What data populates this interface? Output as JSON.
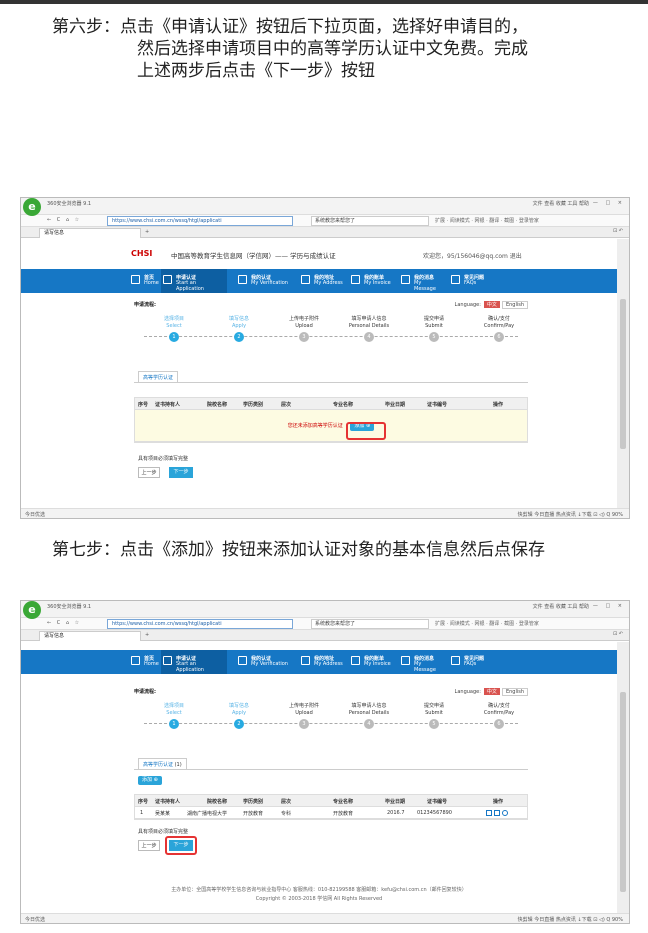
{
  "steps": {
    "step6": [
      "第六步：点击《申请认证》按钮后下拉页面，选择好申请目的，",
      "然后选择申请项目中的高等学历认证中文免费。完成",
      "上述两步后点击《下一步》按钮"
    ],
    "step7": "第七步：点击《添加》按钮来添加认证对象的基本信息然后点保存"
  },
  "browser": {
    "logo_glyph": "e",
    "title": "360安全浏览器 9.1",
    "menu": "文件  查看  收藏  工具  帮助",
    "nav_buttons": "← C ⌂ ☆",
    "url": "https://www.chsi.com.cn/wssq/htgl/applicati",
    "search": "系统教您来帮您了",
    "addr_tools": "扩展 · 阅读模式 · 网银 · 翻译 · 截图 · 登录管家",
    "tab_title": "请写信息",
    "tab_plus": "+",
    "tab_right": "⊡ ↶",
    "window_buttons": "— □ ×",
    "status_left": "今日优选",
    "status_right": "快剪辑  今日直播  热点资讯  ↓下载  ⊡  ◁)  Q 90%"
  },
  "site": {
    "logo": "CHSI",
    "name": "中国高等教育学生信息网（学信网）—— 学历与成绩认证",
    "user": "欢迎您，95/156046@qq.com   退出",
    "nav": [
      {
        "cn": "首页",
        "en": "Home",
        "en2": ""
      },
      {
        "cn": "申请认证",
        "en": "Start an",
        "en2": "Application"
      },
      {
        "cn": "我的认证",
        "en": "My Verification",
        "en2": ""
      },
      {
        "cn": "我的地址",
        "en": "My Address",
        "en2": ""
      },
      {
        "cn": "我的账单",
        "en": "My Invoice",
        "en2": ""
      },
      {
        "cn": "我的消息",
        "en": "My",
        "en2": "Message"
      },
      {
        "cn": "常见问题",
        "en": "FAQs",
        "en2": ""
      }
    ],
    "progress_title": "申请流程:",
    "lang_label": "Language:",
    "lang_cn": "中文",
    "lang_en": "English",
    "steps": [
      {
        "cn": "选择项目",
        "en": "Select",
        "n": "1"
      },
      {
        "cn": "填写信息",
        "en": "Apply",
        "n": "2"
      },
      {
        "cn": "上传电子附件",
        "en": "Upload",
        "n": "3"
      },
      {
        "cn": "填写申请人信息",
        "en": "Personal Details",
        "n": "4"
      },
      {
        "cn": "提交申请",
        "en": "Submit",
        "n": "5"
      },
      {
        "cn": "确认/支付",
        "en": "Confirm/Pay",
        "n": "6"
      }
    ],
    "section_tab": "高等学历认证",
    "section_tab_count": "(1)",
    "columns": [
      "序号",
      "证书持有人",
      "院校名称",
      "学历类别",
      "层次",
      "专业名称",
      "毕业日期",
      "证书编号",
      "操作"
    ],
    "empty_text": "您还未添加高等学历认证",
    "add_label": "添加",
    "row": [
      "1",
      "吴某某",
      "湖南广播电视大学",
      "开放教育",
      "专科",
      "开放教育",
      "2016.7",
      "01234567890"
    ],
    "hint": "具有项目必须填写完整",
    "prev": "上一步",
    "next": "下一步",
    "footer1": "主办单位：全国高等学校学生信息咨询与就业指导中心   客服热线：010-82199588   客服邮箱：kefu@chsi.com.cn（邮件回复较快）",
    "footer2": "Copyright © 2003-2018 学信网 All Rights Reserved"
  }
}
